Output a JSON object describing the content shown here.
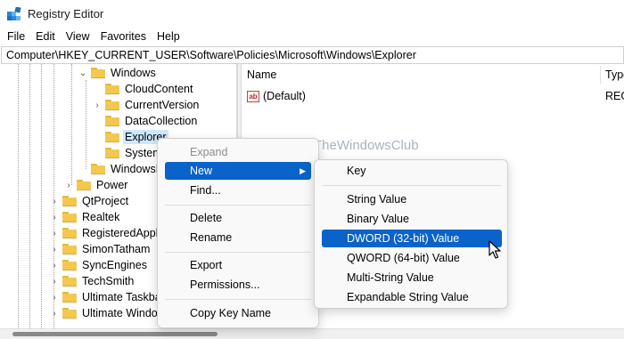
{
  "window": {
    "title": "Registry Editor"
  },
  "menubar": [
    "File",
    "Edit",
    "View",
    "Favorites",
    "Help"
  ],
  "address": "Computer\\HKEY_CURRENT_USER\\Software\\Policies\\Microsoft\\Windows\\Explorer",
  "tree": {
    "windows": "Windows",
    "cloudcontent": "CloudContent",
    "currentversion": "CurrentVersion",
    "datacollection": "DataCollection",
    "explorer": "Explorer",
    "system": "System",
    "windowsm": "WindowsM",
    "power": "Power",
    "qtproject": "QtProject",
    "realtek": "Realtek",
    "registeredappli": "RegisteredAppli",
    "simontatham": "SimonTatham",
    "syncengines": "SyncEngines",
    "techsmith": "TechSmith",
    "ultimatetaskbar": "Ultimate Taskba",
    "ultimatewindow": "Ultimate Windo"
  },
  "list": {
    "col_name": "Name",
    "col_type": "Type",
    "rows": [
      {
        "name": "(Default)",
        "type": "REG"
      }
    ]
  },
  "watermark": "TheWindowsClub",
  "context_menu": {
    "expand": "Expand",
    "new": "New",
    "find": "Find...",
    "delete": "Delete",
    "rename": "Rename",
    "export": "Export",
    "permissions": "Permissions...",
    "copy_key_name": "Copy Key Name"
  },
  "new_submenu": {
    "key": "Key",
    "string_value": "String Value",
    "binary_value": "Binary Value",
    "dword_value": "DWORD (32-bit) Value",
    "qword_value": "QWORD (64-bit) Value",
    "multi_string_value": "Multi-String Value",
    "expandable_string_value": "Expandable String Value"
  },
  "colors": {
    "highlight": "#0a63c9",
    "selection": "#cce8ff",
    "folder": "#f3c851"
  }
}
